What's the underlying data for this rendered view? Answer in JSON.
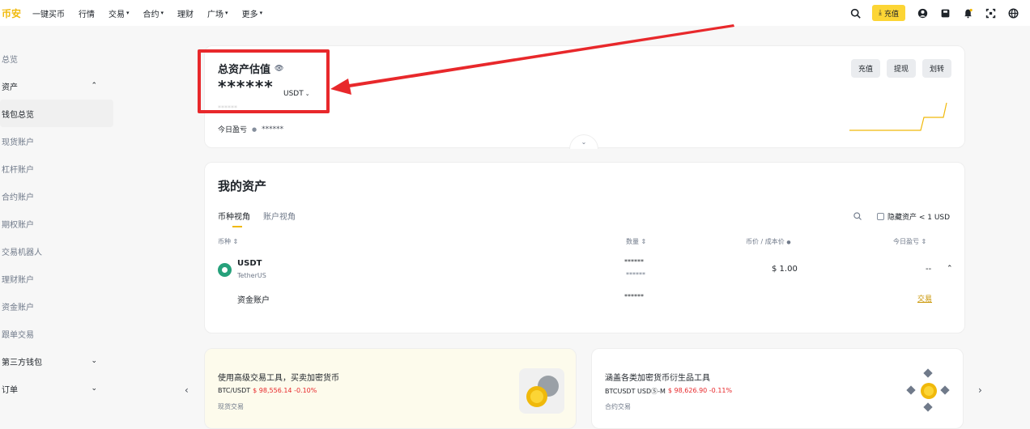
{
  "nav": {
    "logo": "币安",
    "items": [
      {
        "label": "一键买币",
        "caret": false
      },
      {
        "label": "行情",
        "caret": false
      },
      {
        "label": "交易",
        "caret": true
      },
      {
        "label": "合约",
        "caret": true
      },
      {
        "label": "理财",
        "caret": false
      },
      {
        "label": "广场",
        "caret": true
      },
      {
        "label": "更多",
        "caret": true
      }
    ],
    "deposit_label": "充值"
  },
  "sidebar": {
    "items": [
      {
        "label": "总览",
        "type": "item"
      },
      {
        "label": "资产",
        "type": "section",
        "chevron": "⌃"
      },
      {
        "label": "钱包总览",
        "type": "active"
      },
      {
        "label": "现货账户",
        "type": "item"
      },
      {
        "label": "杠杆账户",
        "type": "item"
      },
      {
        "label": "合约账户",
        "type": "item"
      },
      {
        "label": "期权账户",
        "type": "item"
      },
      {
        "label": "交易机器人",
        "type": "item"
      },
      {
        "label": "理财账户",
        "type": "item"
      },
      {
        "label": "资金账户",
        "type": "item"
      },
      {
        "label": "跟单交易",
        "type": "item"
      },
      {
        "label": "第三方钱包",
        "type": "section",
        "chevron": "⌄"
      },
      {
        "label": "订单",
        "type": "section",
        "chevron": "⌄"
      }
    ]
  },
  "overview": {
    "title": "总资产估值",
    "value_masked": "******",
    "currency": "USDT",
    "small_mask": "******",
    "pnl_label": "今日盈亏",
    "pnl_value": "******",
    "actions": [
      "充值",
      "提现",
      "划转"
    ]
  },
  "assets": {
    "title": "我的资产",
    "tabs": [
      "币种视角",
      "账户视角"
    ],
    "hide_small": "隐藏资产 < 1 USD",
    "headers": {
      "coin": "币种 ⇕",
      "amount": "数量 ⇕",
      "price": "币价 / 成本价",
      "pnl": "今日盈亏 ⇕"
    },
    "row": {
      "symbol": "USDT",
      "name": "TetherUS",
      "amount": "******",
      "amount_sub": "******",
      "price": "$ 1.00",
      "pnl": "--"
    },
    "subrow": {
      "account": "资金账户",
      "amount": "******",
      "action": "交易"
    }
  },
  "promos": [
    {
      "title": "使用高级交易工具，买卖加密货币",
      "pair": "BTC/USDT",
      "price": "$ 98,556.14 -0.10%",
      "label": "现货交易"
    },
    {
      "title": "涵盖各类加密货币衍生品工具",
      "pair": "BTCUSDT USDⓈ-M",
      "price": "$ 98,626.90 -0.11%",
      "label": "合约交易"
    }
  ],
  "colors": {
    "accent": "#f0b90b",
    "highlight": "#e8282b"
  }
}
